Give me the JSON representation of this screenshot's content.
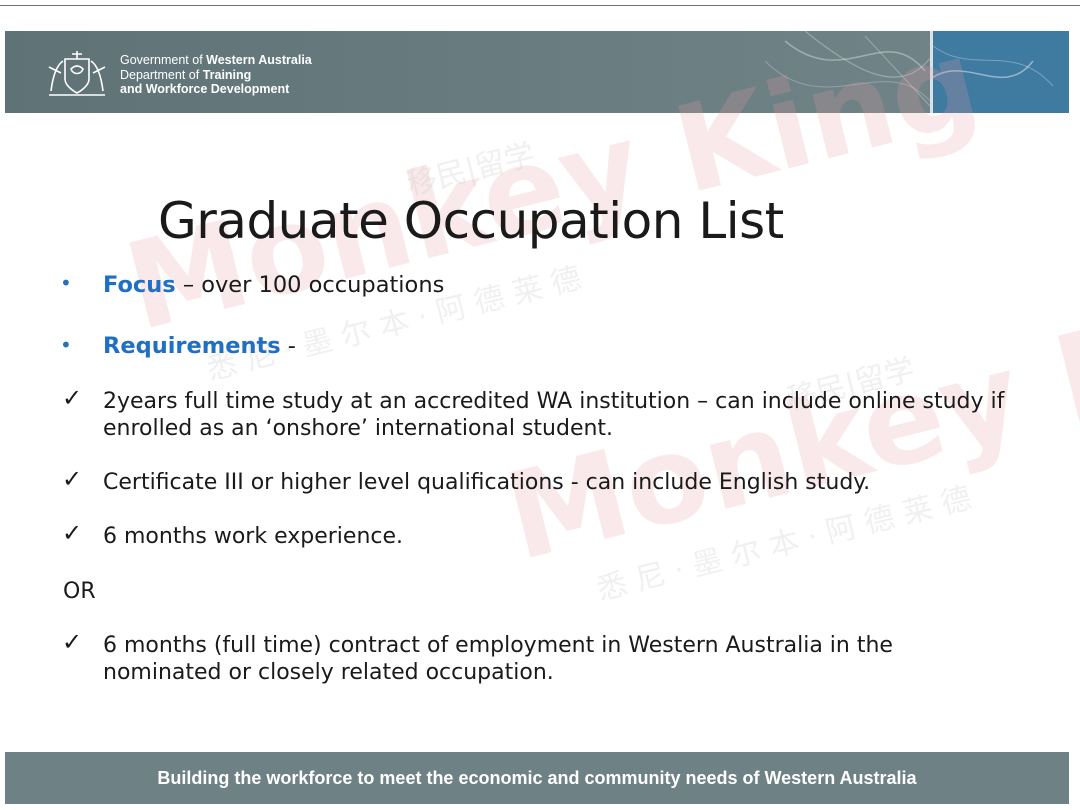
{
  "header": {
    "gov_line1_prefix": "Government of ",
    "gov_line1_bold": "Western Australia",
    "gov_line2_prefix": "Department of ",
    "gov_line2_bold": "Training",
    "gov_line3_bold": "and Workforce Development",
    "crest_icon": "wa-coat-of-arms-icon"
  },
  "slide": {
    "title": "Graduate Occupation List",
    "focus": {
      "label": "Focus",
      "text": " – over 100 occupations"
    },
    "requirements": {
      "label": "Requirements",
      "text": " -"
    },
    "items": [
      {
        "line1": "2years full time study at an accredited WA institution – can include online study if",
        "line2": "enrolled as an ‘onshore’ international student."
      },
      {
        "line1": "Certificate III or higher level qualifications - can include English study."
      },
      {
        "line1": "6 months work experience."
      }
    ],
    "or_label": "OR",
    "last_item": {
      "line1": "6 months (full time) contract of employment  in Western Australia in the",
      "line2": "nominated or closely related occupation."
    }
  },
  "footer": {
    "text": "Building the workforce to meet the economic and community needs of Western Australia"
  },
  "watermark": {
    "brand": "Monkey King",
    "cn_a": "移民|留学",
    "cn_b": "悉 尼 · 墨 尔 本 · 阿 德 莱 德"
  },
  "colors": {
    "header_band": "#657a7e",
    "header_blue": "#3f7aa0",
    "highlight_blue": "#1f6fc4",
    "footer_band": "#6e8185",
    "watermark_red": "#e8b4b8"
  }
}
